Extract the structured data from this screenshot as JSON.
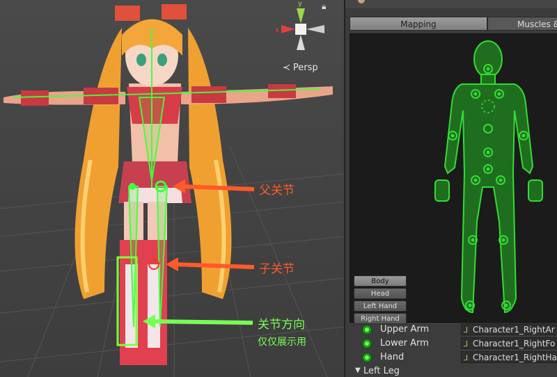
{
  "scene": {
    "view_mode": "Persp",
    "gizmo": {
      "x_label": "x",
      "y_label": "y"
    },
    "annotations": {
      "parent_joint": "父关节",
      "child_joint": "子关节",
      "joint_direction": "关节方向",
      "display_only": "仅仅展示用"
    },
    "colors": {
      "annotation_red": "#ff5a2a",
      "annotation_green": "#77ff55",
      "bone_green": "#40ff40"
    }
  },
  "inspector": {
    "tabs": [
      {
        "label": "Mapping",
        "active": true
      },
      {
        "label": "Muscles &",
        "active": false
      }
    ],
    "view_buttons": [
      {
        "label": "Body",
        "active": true
      },
      {
        "label": "Head",
        "active": false
      },
      {
        "label": "Left Hand",
        "active": false
      },
      {
        "label": "Right Hand",
        "active": false
      }
    ],
    "bones": [
      {
        "name": "Upper Arm",
        "target": "Character1_RightAr"
      },
      {
        "name": "Lower Arm",
        "target": "Character1_RightFo"
      },
      {
        "name": "Hand",
        "target": "Character1_RightHa"
      }
    ],
    "section": {
      "title": "Left Leg",
      "expanded": true
    },
    "colors": {
      "mapped": "#33dd33",
      "avatar_fill": "#1f6e1f"
    }
  }
}
